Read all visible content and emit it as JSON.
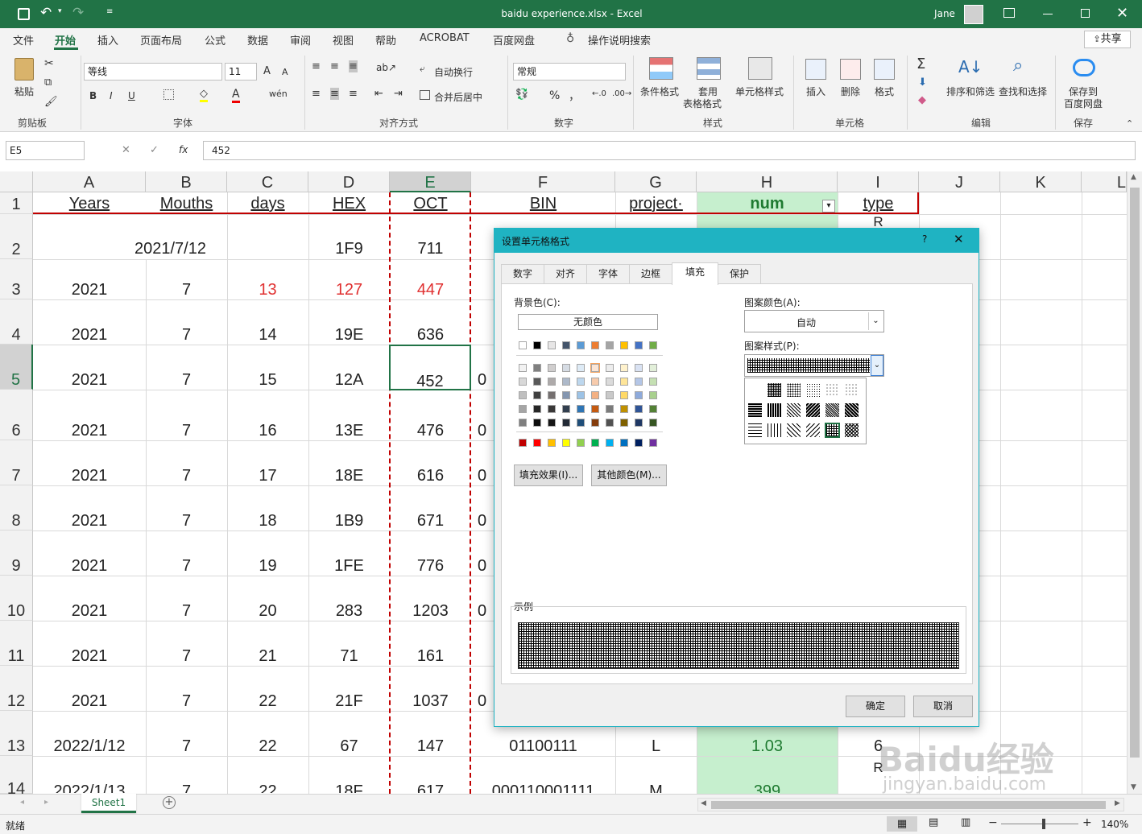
{
  "window": {
    "title": "baidu experience.xlsx  -  Excel",
    "user": "Jane",
    "colors": {
      "title_bg": "#217346",
      "accent": "#217346",
      "dialog_border": "#1fb3c2"
    }
  },
  "menu": {
    "items": [
      "文件",
      "开始",
      "插入",
      "页面布局",
      "公式",
      "数据",
      "审阅",
      "视图",
      "帮助",
      "ACROBAT",
      "百度网盘"
    ],
    "search": "操作说明搜索",
    "share": "共享"
  },
  "ribbon": {
    "paste": "粘贴",
    "clipboard": "剪贴板",
    "font_name": "等线",
    "font_size": "11",
    "font_group": "字体",
    "wrap": "自动换行",
    "merge": "合并后居中",
    "align_group": "对齐方式",
    "number_format": "常规",
    "number_group": "数字",
    "conditional": "条件格式",
    "table_format_1": "套用",
    "table_format_2": "表格格式",
    "cell_style": "单元格样式",
    "styles_group": "样式",
    "insert": "插入",
    "delete": "删除",
    "format": "格式",
    "cells_group": "单元格",
    "sort": "排序和筛选",
    "find": "查找和选择",
    "edit_group": "编辑",
    "save_baidu_1": "保存到",
    "save_baidu_2": "百度网盘",
    "save_group": "保存",
    "bold": "B",
    "italic": "I",
    "underline": "U",
    "percent": "%",
    "comma": "，"
  },
  "formula": {
    "name_box": "E5",
    "fx": "fx",
    "value": "452"
  },
  "columns": [
    "A",
    "B",
    "C",
    "D",
    "E",
    "F",
    "G",
    "H",
    "I",
    "J",
    "K",
    "L"
  ],
  "rows": [
    "1",
    "2",
    "3",
    "4",
    "5",
    "6",
    "7",
    "8",
    "9",
    "10",
    "11",
    "12",
    "13",
    "14"
  ],
  "headers": {
    "A": "Years",
    "B": "Mouths",
    "C": "days",
    "D": "HEX",
    "E": "OCT",
    "F": "BIN",
    "G": "project·",
    "H": "num",
    "I": "type"
  },
  "cells": {
    "r2": {
      "AB": "2021/7/12",
      "D": "1F9",
      "E": "711",
      "I": "R"
    },
    "r3": {
      "A": "2021",
      "B": "7",
      "C": "13",
      "D": "127",
      "E": "447"
    },
    "r4": {
      "A": "2021",
      "B": "7",
      "C": "14",
      "D": "19E",
      "E": "636"
    },
    "r5": {
      "A": "2021",
      "B": "7",
      "C": "15",
      "D": "12A",
      "E": "452",
      "F": "0"
    },
    "r6": {
      "A": "2021",
      "B": "7",
      "C": "16",
      "D": "13E",
      "E": "476",
      "F": "0"
    },
    "r7": {
      "A": "2021",
      "B": "7",
      "C": "17",
      "D": "18E",
      "E": "616",
      "F": "0"
    },
    "r8": {
      "A": "2021",
      "B": "7",
      "C": "18",
      "D": "1B9",
      "E": "671",
      "F": "0"
    },
    "r9": {
      "A": "2021",
      "B": "7",
      "C": "19",
      "D": "1FE",
      "E": "776",
      "F": "0"
    },
    "r10": {
      "A": "2021",
      "B": "7",
      "C": "20",
      "D": "283",
      "E": "1203",
      "F": "0"
    },
    "r11": {
      "A": "2021",
      "B": "7",
      "C": "21",
      "D": "71",
      "E": "161"
    },
    "r12": {
      "A": "2021",
      "B": "7",
      "C": "22",
      "D": "21F",
      "E": "1037",
      "F": "0"
    },
    "r13": {
      "A": "2022/1/12",
      "B": "7",
      "C": "22",
      "D": "67",
      "E": "147",
      "F": "01100111",
      "G": "L",
      "H": "1.03",
      "I": "6"
    },
    "r14": {
      "A": "2022/1/13",
      "B": "7",
      "C": "22",
      "D": "18F",
      "E": "617",
      "F": "000110001111",
      "G": "M",
      "H": "399",
      "I": "R"
    }
  },
  "dialog": {
    "title": "设置单元格格式",
    "help": "?",
    "tabs": [
      "数字",
      "对齐",
      "字体",
      "边框",
      "填充",
      "保护"
    ],
    "bg_color_label": "背景色(C):",
    "no_color": "无颜色",
    "pattern_color_label": "图案颜色(A):",
    "pattern_color_value": "自动",
    "pattern_style_label": "图案样式(P):",
    "fill_effects": "填充效果(I)...",
    "more_colors": "其他颜色(M)...",
    "sample": "示例",
    "ok": "确定",
    "cancel": "取消"
  },
  "sheet": {
    "tab": "Sheet1"
  },
  "status": {
    "ready": "就绪",
    "zoom": "140%"
  },
  "watermark": {
    "brand": "Baidu经验",
    "url": "jingyan.baidu.com"
  }
}
